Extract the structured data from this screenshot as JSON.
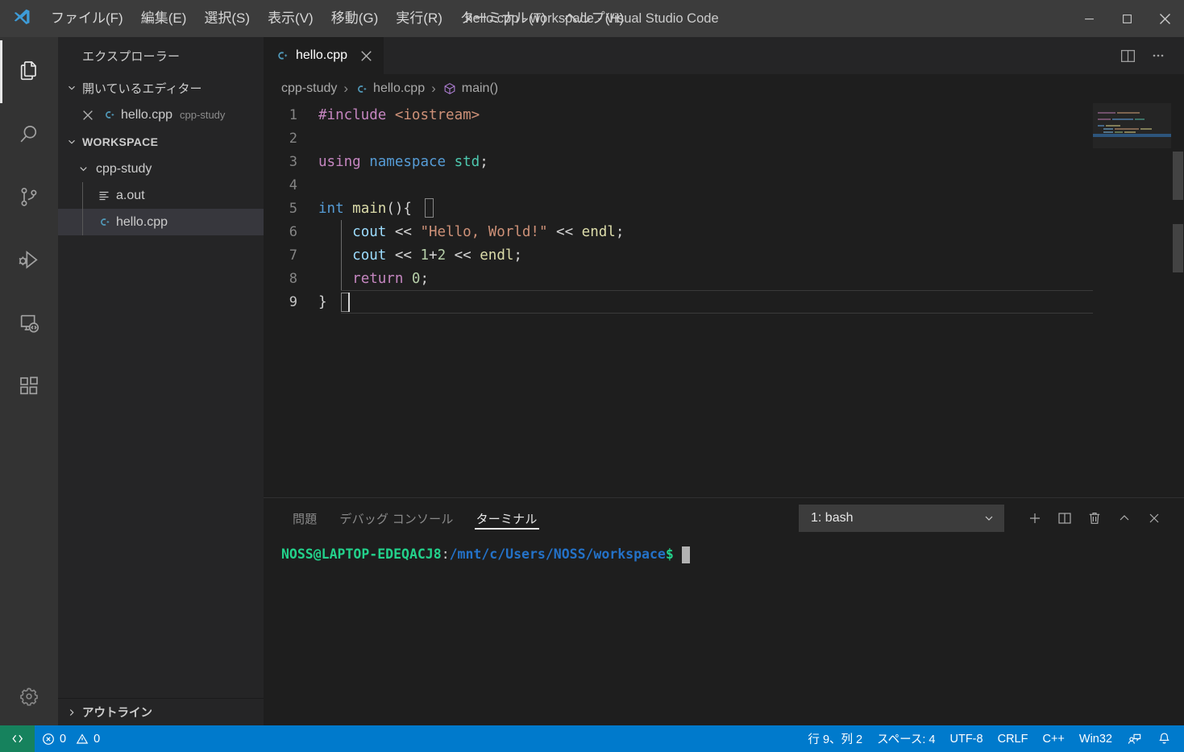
{
  "titlebar": {
    "menus": [
      {
        "label": "ファイル(F)",
        "name": "menu-file"
      },
      {
        "label": "編集(E)",
        "name": "menu-edit"
      },
      {
        "label": "選択(S)",
        "name": "menu-selection"
      },
      {
        "label": "表示(V)",
        "name": "menu-view"
      },
      {
        "label": "移動(G)",
        "name": "menu-go"
      },
      {
        "label": "実行(R)",
        "name": "menu-run"
      },
      {
        "label": "ターミナル(T)",
        "name": "menu-terminal"
      },
      {
        "label": "ヘルプ(H)",
        "name": "menu-help"
      }
    ],
    "title": "hello.cpp - workspace - Visual Studio Code",
    "window_controls": [
      "minimize-button",
      "maximize-button",
      "close-button"
    ]
  },
  "activitybar": {
    "items": [
      {
        "name": "activity-explorer",
        "icon": "files-icon",
        "active": true
      },
      {
        "name": "activity-search",
        "icon": "search-icon",
        "active": false
      },
      {
        "name": "activity-source-control",
        "icon": "source-control-icon",
        "active": false
      },
      {
        "name": "activity-run-debug",
        "icon": "run-debug-icon",
        "active": false
      },
      {
        "name": "activity-remote-explorer",
        "icon": "remote-explorer-icon",
        "active": false
      },
      {
        "name": "activity-extensions",
        "icon": "extensions-icon",
        "active": false
      }
    ],
    "bottom": [
      {
        "name": "activity-manage-settings",
        "icon": "gear-icon"
      }
    ]
  },
  "sidebar": {
    "title": "エクスプローラー",
    "open_editors": {
      "header": "開いているエディター",
      "expanded": true,
      "items": [
        {
          "name": "hello.cpp",
          "description": "cpp-study",
          "icon": "cpp-file-icon"
        }
      ]
    },
    "workspace": {
      "header": "WORKSPACE",
      "expanded": true,
      "folders": [
        {
          "name": "cpp-study",
          "expanded": true,
          "files": [
            {
              "name": "a.out",
              "icon": "binary-file-icon",
              "selected": false
            },
            {
              "name": "hello.cpp",
              "icon": "cpp-file-icon",
              "selected": true
            }
          ]
        }
      ]
    },
    "outline": {
      "header": "アウトライン",
      "expanded": false
    }
  },
  "editor": {
    "tabs": [
      {
        "label": "hello.cpp",
        "icon": "cpp-file-icon",
        "active": true
      }
    ],
    "actions": [
      {
        "name": "split-editor-button",
        "icon": "split-editor-icon"
      },
      {
        "name": "more-actions-button",
        "icon": "ellipsis-icon"
      }
    ],
    "breadcrumb": [
      {
        "label": "cpp-study",
        "icon": null
      },
      {
        "label": "hello.cpp",
        "icon": "cpp-file-icon"
      },
      {
        "label": "main()",
        "icon": "symbol-method-icon"
      }
    ],
    "separator": "›",
    "lines": [
      {
        "num": "1",
        "tokens": [
          {
            "t": "#include",
            "c": "tok-pp"
          },
          {
            "t": " ",
            "c": "tok-pl"
          },
          {
            "t": "<iostream>",
            "c": "tok-inc"
          }
        ]
      },
      {
        "num": "2",
        "tokens": []
      },
      {
        "num": "3",
        "tokens": [
          {
            "t": "using",
            "c": "tok-kw2"
          },
          {
            "t": " ",
            "c": "tok-pl"
          },
          {
            "t": "namespace",
            "c": "tok-kw"
          },
          {
            "t": " ",
            "c": "tok-pl"
          },
          {
            "t": "std",
            "c": "tok-type"
          },
          {
            "t": ";",
            "c": "tok-pl"
          }
        ]
      },
      {
        "num": "4",
        "tokens": []
      },
      {
        "num": "5",
        "tokens": [
          {
            "t": "int",
            "c": "tok-kw"
          },
          {
            "t": " ",
            "c": "tok-pl"
          },
          {
            "t": "main",
            "c": "tok-fn"
          },
          {
            "t": "()",
            "c": "tok-pl"
          },
          {
            "t": "{",
            "c": "tok-pl"
          }
        ]
      },
      {
        "num": "6",
        "tokens": [
          {
            "t": "    ",
            "c": "tok-pl"
          },
          {
            "t": "cout",
            "c": "tok-var"
          },
          {
            "t": " ",
            "c": "tok-pl"
          },
          {
            "t": "<<",
            "c": "tok-pl"
          },
          {
            "t": " ",
            "c": "tok-pl"
          },
          {
            "t": "\"Hello, World!\"",
            "c": "tok-str"
          },
          {
            "t": " ",
            "c": "tok-pl"
          },
          {
            "t": "<<",
            "c": "tok-pl"
          },
          {
            "t": " ",
            "c": "tok-pl"
          },
          {
            "t": "endl",
            "c": "tok-fn"
          },
          {
            "t": ";",
            "c": "tok-pl"
          }
        ]
      },
      {
        "num": "7",
        "tokens": [
          {
            "t": "    ",
            "c": "tok-pl"
          },
          {
            "t": "cout",
            "c": "tok-var"
          },
          {
            "t": " ",
            "c": "tok-pl"
          },
          {
            "t": "<<",
            "c": "tok-pl"
          },
          {
            "t": " ",
            "c": "tok-pl"
          },
          {
            "t": "1",
            "c": "tok-num"
          },
          {
            "t": "+",
            "c": "tok-pl"
          },
          {
            "t": "2",
            "c": "tok-num"
          },
          {
            "t": " ",
            "c": "tok-pl"
          },
          {
            "t": "<<",
            "c": "tok-pl"
          },
          {
            "t": " ",
            "c": "tok-pl"
          },
          {
            "t": "endl",
            "c": "tok-fn"
          },
          {
            "t": ";",
            "c": "tok-pl"
          }
        ]
      },
      {
        "num": "8",
        "tokens": [
          {
            "t": "    ",
            "c": "tok-pl"
          },
          {
            "t": "return",
            "c": "tok-kw2"
          },
          {
            "t": " ",
            "c": "tok-pl"
          },
          {
            "t": "0",
            "c": "tok-num"
          },
          {
            "t": ";",
            "c": "tok-pl"
          }
        ]
      },
      {
        "num": "9",
        "tokens": [
          {
            "t": "}",
            "c": "tok-pl"
          }
        ]
      }
    ],
    "active_line": 9
  },
  "panel": {
    "tabs": [
      {
        "label": "問題",
        "name": "panel-tab-problems",
        "active": false
      },
      {
        "label": "デバッグ コンソール",
        "name": "panel-tab-debug-console",
        "active": false
      },
      {
        "label": "ターミナル",
        "name": "panel-tab-terminal",
        "active": true
      }
    ],
    "terminal_select": {
      "value": "1: bash",
      "icon": "chevron-down-icon"
    },
    "actions": [
      {
        "name": "new-terminal-button",
        "icon": "plus-icon"
      },
      {
        "name": "split-terminal-button",
        "icon": "split-icon"
      },
      {
        "name": "kill-terminal-button",
        "icon": "trash-icon"
      },
      {
        "name": "maximize-panel-button",
        "icon": "chevron-up-icon"
      },
      {
        "name": "close-panel-button",
        "icon": "close-icon"
      }
    ],
    "terminal_line": {
      "user": "NOSS@LAPTOP-EDEQACJ8",
      "colon": ":",
      "path": "/mnt/c/Users/NOSS/workspace",
      "dollar": "$"
    }
  },
  "statusbar": {
    "remote": {
      "label": "",
      "icon": "remote-icon"
    },
    "left": [
      {
        "name": "status-errors-warnings",
        "error_icon": "error-icon",
        "errors": "0",
        "warning_icon": "warning-icon",
        "warnings": "0"
      }
    ],
    "right": [
      {
        "name": "status-cursor-position",
        "label": "行 9、列 2"
      },
      {
        "name": "status-indentation",
        "label": "スペース: 4"
      },
      {
        "name": "status-encoding",
        "label": "UTF-8"
      },
      {
        "name": "status-eol",
        "label": "CRLF"
      },
      {
        "name": "status-language-mode",
        "label": "C++"
      },
      {
        "name": "status-platform",
        "label": "Win32"
      },
      {
        "name": "status-feedback",
        "label": "",
        "icon": "feedback-icon"
      },
      {
        "name": "status-notifications",
        "label": "",
        "icon": "bell-icon"
      }
    ]
  },
  "colors": {
    "accent": "#007acc",
    "remote_green": "#16825d",
    "titlebar_bg": "#3c3c3c",
    "sidebar_bg": "#252526",
    "editor_bg": "#1e1e1e",
    "activitybar_bg": "#333333"
  }
}
